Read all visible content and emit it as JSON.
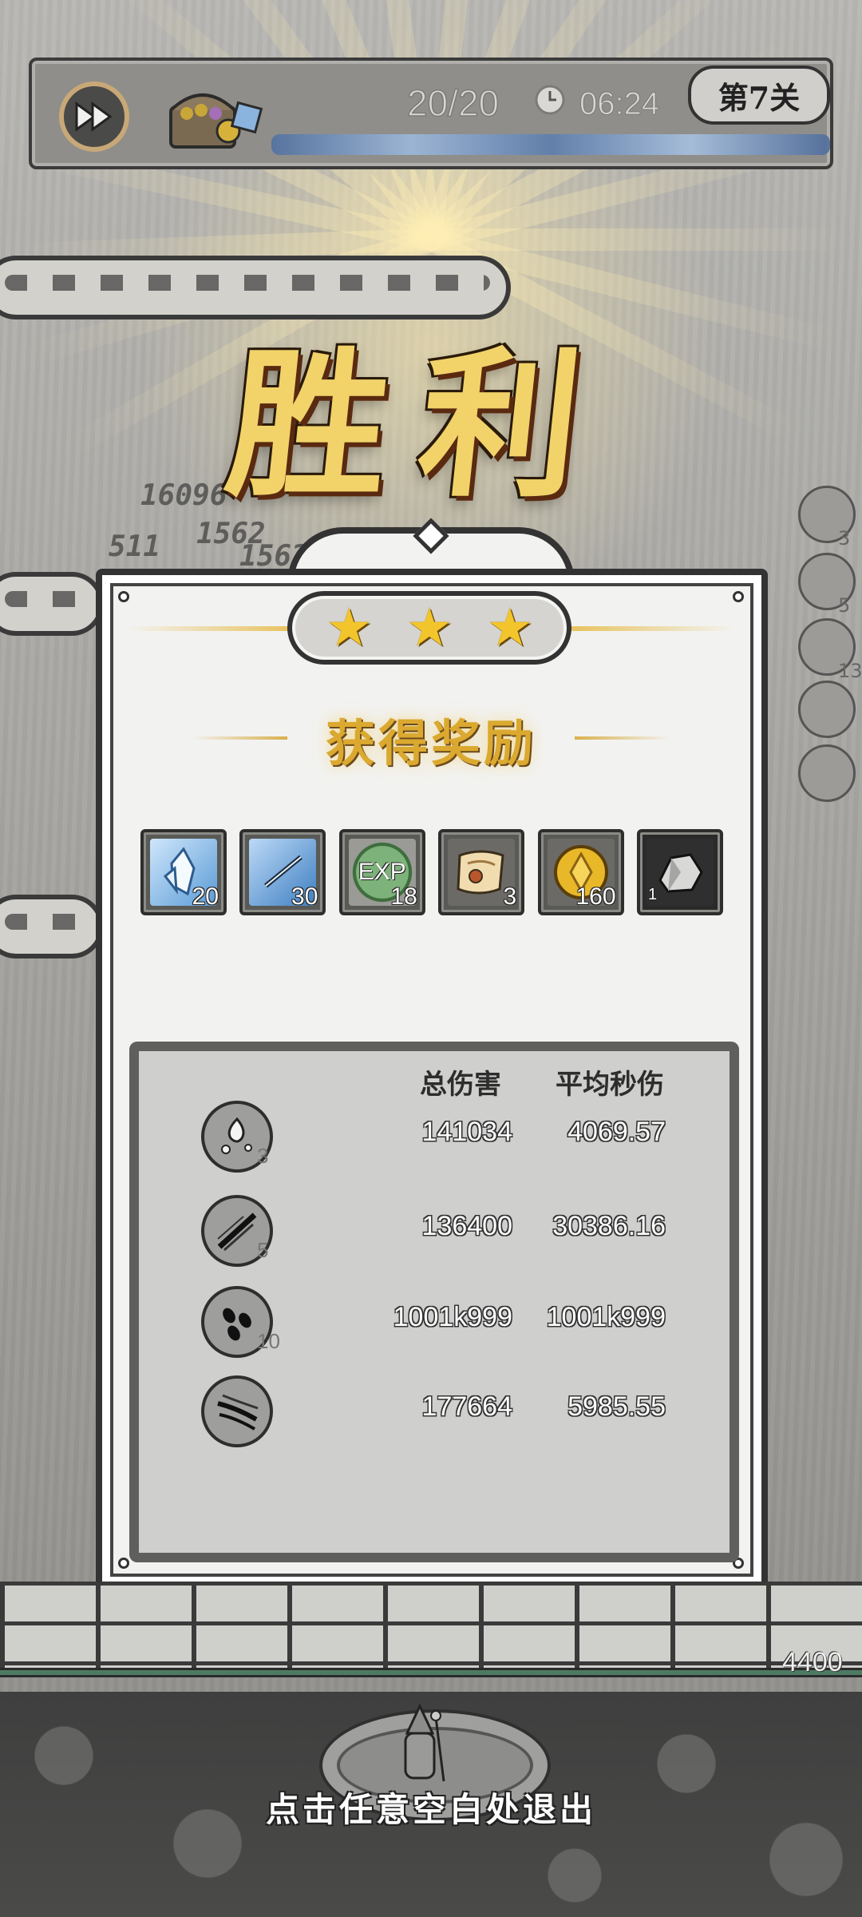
{
  "top_bar": {
    "wave_counter": "20/20",
    "timer": "06:24",
    "level_label": "第7关"
  },
  "victory_title": "胜利",
  "stars": [
    "★",
    "★",
    "★"
  ],
  "reward_section_title": "获得奖励",
  "rewards": [
    {
      "icon": "blue-crystal-icon",
      "qty": "20"
    },
    {
      "icon": "blue-shard-icon",
      "qty": "30"
    },
    {
      "icon": "exp-orb-icon",
      "label": "EXP",
      "qty": "18"
    },
    {
      "icon": "scroll-icon",
      "qty": "3"
    },
    {
      "icon": "gold-coin-icon",
      "qty": "160"
    },
    {
      "icon": "ore-stone-icon",
      "qty": "1"
    }
  ],
  "stats": {
    "header_total": "总伤害",
    "header_dps": "平均秒伤",
    "rows": [
      {
        "icon": "splash-skill-icon",
        "level": "3",
        "total": "141034",
        "dps": "4069.57"
      },
      {
        "icon": "slash-skill-icon",
        "level": "5",
        "total": "136400",
        "dps": "30386.16"
      },
      {
        "icon": "droplets-skill-icon",
        "level": "10",
        "total": "1001k999",
        "dps": "1001k999"
      },
      {
        "icon": "crack-skill-icon",
        "level": "",
        "total": "177664",
        "dps": "5985.55"
      }
    ]
  },
  "floating_damage": [
    "16096",
    "1562",
    "511",
    "1562"
  ],
  "right_column_levels": [
    "3",
    "5",
    "13"
  ],
  "base_hp": "4400",
  "exit_hint": "点击任意空白处退出",
  "colors": {
    "star": "#f3c52c",
    "title_gold": "#f1d36a",
    "reward_gold": "#dba930"
  }
}
